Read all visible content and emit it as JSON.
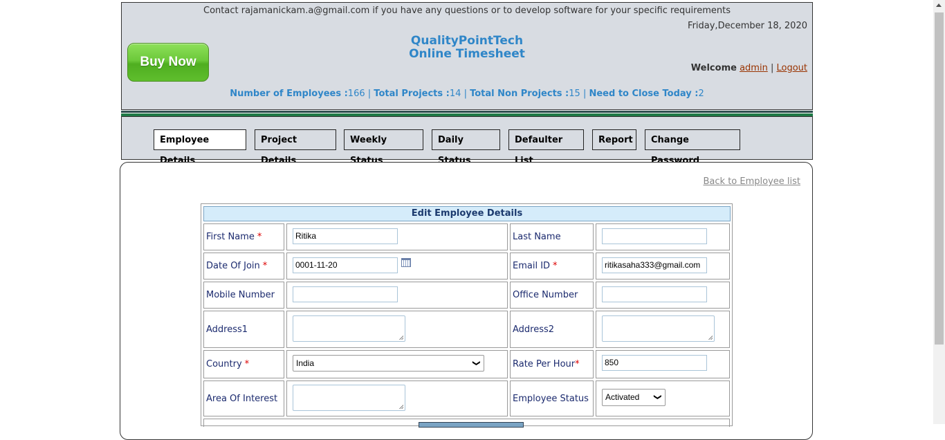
{
  "header": {
    "contact": "Contact rajamanickam.a@gmail.com if you have any questions or to develop software for your specific requirements",
    "date": "Friday,December 18, 2020",
    "buy_now": "Buy Now",
    "title_line1": "QualityPointTech",
    "title_line2": "Online Timesheet",
    "welcome": "Welcome",
    "user": "admin",
    "separator": "|",
    "logout": "Logout",
    "stats": [
      {
        "label": "Number of Employees :",
        "value": "166"
      },
      {
        "label": "Total Projects :",
        "value": "14"
      },
      {
        "label": "Total Non Projects :",
        "value": "15"
      },
      {
        "label": "Need to Close Today :",
        "value": "2"
      }
    ]
  },
  "nav": {
    "tabs": [
      {
        "label": "Employee Details"
      },
      {
        "label": "Project Details"
      },
      {
        "label": "Weekly Status"
      },
      {
        "label": "Daily Status"
      },
      {
        "label": "Defaulter List"
      },
      {
        "label": "Report"
      },
      {
        "label": "Change Password"
      }
    ]
  },
  "content": {
    "back_link": "Back to Employee list"
  },
  "form": {
    "title": "Edit Employee Details",
    "required_mark": "*",
    "first_name": {
      "label": "First Name",
      "value": "Ritika"
    },
    "last_name": {
      "label": "Last Name",
      "value": ""
    },
    "date_of_join": {
      "label": "Date Of Join",
      "value": "0001-11-20"
    },
    "email": {
      "label": "Email ID",
      "value": "ritikasaha333@gmail.com"
    },
    "mobile": {
      "label": "Mobile Number",
      "value": ""
    },
    "office": {
      "label": "Office Number",
      "value": ""
    },
    "address1": {
      "label": "Address1",
      "value": ""
    },
    "address2": {
      "label": "Address2",
      "value": ""
    },
    "country": {
      "label": "Country",
      "value": "India"
    },
    "rate": {
      "label": "Rate Per Hour",
      "value": "850"
    },
    "area": {
      "label": "Area Of Interest",
      "value": ""
    },
    "status": {
      "label": "Employee Status",
      "value": "Activated"
    }
  }
}
